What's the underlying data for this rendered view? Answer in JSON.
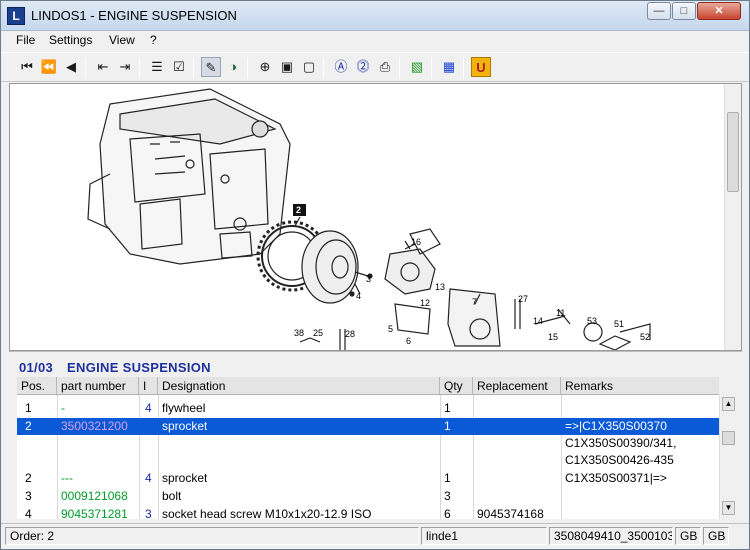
{
  "window": {
    "title": "LINDOS1 - ENGINE SUSPENSION",
    "app_icon": "L",
    "minimize": "—",
    "maximize": "□",
    "close": "✕"
  },
  "menu": [
    "File",
    "Settings",
    "View",
    "?"
  ],
  "toolbar": {
    "icons": [
      "first-page-icon",
      "previous-fast-icon",
      "previous-icon",
      "first-doc-icon",
      "next-doc-icon",
      "cart-icon",
      "checklist-icon",
      "pen-icon",
      "globe-icon",
      "zoom-in-icon",
      "fit-page-icon",
      "page-icon",
      "info-a-icon",
      "help-icon",
      "print-icon",
      "green-stack-icon",
      "blue-grid-icon",
      "u-icon"
    ]
  },
  "drawing": {
    "callouts": [
      "2",
      "16",
      "3",
      "4",
      "5",
      "6",
      "7",
      "27",
      "11",
      "14",
      "15",
      "53",
      "51",
      "52",
      "38",
      "25",
      "28",
      "12",
      "13"
    ]
  },
  "parts": {
    "page": "01/03",
    "section": "ENGINE SUSPENSION",
    "columns": [
      "Pos.",
      "part number",
      "I",
      "Designation",
      "Qty",
      "Replacement",
      "Remarks"
    ],
    "rows": [
      {
        "pos": "1",
        "part": "-",
        "ind": "4",
        "designation": "flywheel",
        "qty": "1",
        "replacement": "",
        "remarks": ""
      },
      {
        "pos": "2",
        "part": "3500321200",
        "ind": "",
        "designation": "sprocket",
        "qty": "1",
        "replacement": "",
        "remarks": "=>|C1X350S00370",
        "remarks2": "C1X350S00390/341,",
        "remarks3": "C1X350S00426-435",
        "selected": true
      },
      {
        "pos": "2",
        "part": "---",
        "ind": "4",
        "designation": "sprocket",
        "qty": "1",
        "replacement": "",
        "remarks": "C1X350S00371|=>"
      },
      {
        "pos": "3",
        "part": "0009121068",
        "ind": "",
        "designation": "bolt",
        "qty": "3",
        "replacement": "",
        "remarks": ""
      },
      {
        "pos": "4",
        "part": "9045371281",
        "ind": "3",
        "designation": "socket head screw M10x1x20-12.9 ISO",
        "qty": "6",
        "replacement": "9045374168",
        "remarks": ""
      }
    ]
  },
  "status": {
    "order": "Order: 2",
    "user": "linde1",
    "ref": "3508049410_3500103",
    "lang1": "GB",
    "lang2": "GB"
  },
  "colors": {
    "selection": "#0a5ad8",
    "title_blue": "#1e2f9e",
    "part_green": "#009a28",
    "part_purple": "#a22ebd"
  }
}
